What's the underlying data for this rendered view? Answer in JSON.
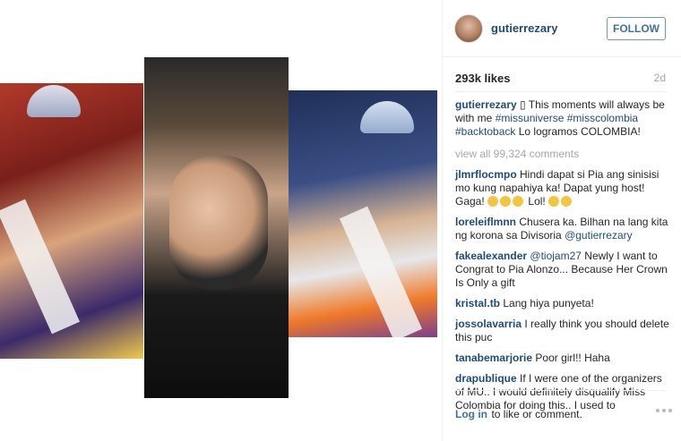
{
  "post": {
    "username": "gutierrezary",
    "follow_label": "FOLLOW",
    "likes": "293k likes",
    "age": "2d",
    "caption": {
      "user": "gutierrezary",
      "lead": "▯ This moments will always be with me ",
      "tag1": "#missuniverse",
      "tag2": "#misscolombia",
      "tag3": "#backtoback",
      "tail": " Lo logramos COLOMBIA!"
    },
    "view_all": "view all 99,324 comments"
  },
  "comments": [
    {
      "user": "jlmrflocmpo",
      "text": "Hindi dapat si Pia ang sinisisi mo kung napahiya ka! Dapat yung host! Gaga!",
      "suffix": "Lol!"
    },
    {
      "user": "loreleiflmnn",
      "text": "Chusera ka. Bilhan na lang kita ng korona sa Divisoria",
      "mention": "@gutierrezary"
    },
    {
      "user": "fakealexander",
      "mention": "@tiojam27",
      "text": "Newly I want to Congrat to Pia Alonzo... Because Her Crown Is Only a gift"
    },
    {
      "user": "kristal.tb",
      "text": "Lang hiya punyeta!"
    },
    {
      "user": "jossolavarria",
      "text": "I really think you should delete this puc"
    },
    {
      "user": "tanabemarjorie",
      "text": "Poor girl!! Haha"
    },
    {
      "user": "drapublique",
      "text": "If I were one of the organizers of MU.. I would definitely disqualify Miss Colombia for doing this.. I used to"
    }
  ],
  "footer": {
    "login_link": "Log in",
    "login_text": "to like or comment."
  },
  "icons": {
    "avatar": "profile-avatar",
    "more": "more-options-icon"
  },
  "colors": {
    "link": "#1e4c7a",
    "follow": "#3f729b",
    "muted": "#a5a7aa"
  }
}
